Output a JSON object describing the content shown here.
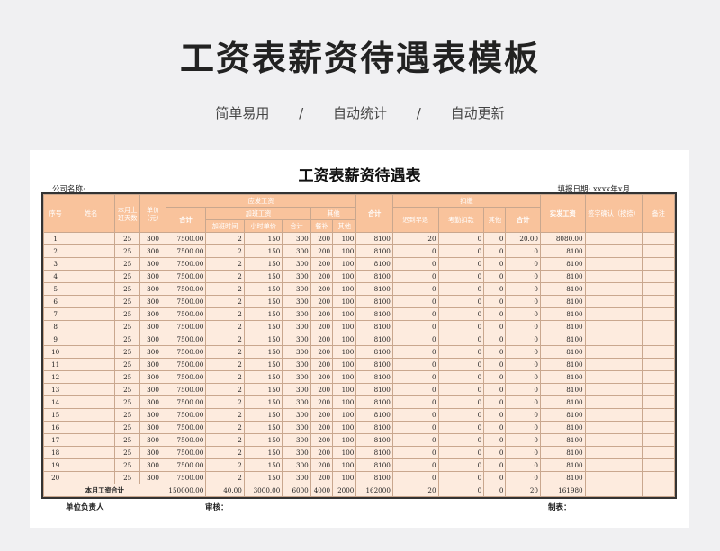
{
  "page": {
    "title": "工资表薪资待遇表模板",
    "taglines": [
      "简单易用",
      "/",
      "自动统计",
      "/",
      "自动更新"
    ]
  },
  "sheet": {
    "title": "工资表薪资待遇表",
    "company_label": "公司名称:",
    "date_label": "填报日期:  xxxx年x月",
    "headers": {
      "seq": "序号",
      "name": "姓名",
      "days": "本月上班天数",
      "unit_price": "单价（元）",
      "payable": "应发工资",
      "deduct": "扣缴",
      "actual": "实发工资",
      "sign": "签字确认（按捺）",
      "remark": "备注",
      "subtotal": "合计",
      "overtime": "加班工资",
      "other": "其他",
      "ot_hours": "加班时间",
      "hourly": "小时单价",
      "meal": "餐补",
      "late": "迟到早退",
      "absence": "考勤扣款"
    },
    "rows": [
      {
        "seq": "1",
        "days": "25",
        "price": "300",
        "subtotal": "7500.00",
        "ot_hours": "2",
        "hourly": "150",
        "ot_total": "300",
        "meal": "200",
        "other": "100",
        "payable": "8100",
        "late": "20",
        "absence": "0",
        "ded_other": "0",
        "ded_total": "20.00",
        "actual": "8080.00"
      },
      {
        "seq": "2",
        "days": "25",
        "price": "300",
        "subtotal": "7500.00",
        "ot_hours": "2",
        "hourly": "150",
        "ot_total": "300",
        "meal": "200",
        "other": "100",
        "payable": "8100",
        "late": "0",
        "absence": "0",
        "ded_other": "0",
        "ded_total": "0",
        "actual": "8100"
      },
      {
        "seq": "3",
        "days": "25",
        "price": "300",
        "subtotal": "7500.00",
        "ot_hours": "2",
        "hourly": "150",
        "ot_total": "300",
        "meal": "200",
        "other": "100",
        "payable": "8100",
        "late": "0",
        "absence": "0",
        "ded_other": "0",
        "ded_total": "0",
        "actual": "8100"
      },
      {
        "seq": "4",
        "days": "25",
        "price": "300",
        "subtotal": "7500.00",
        "ot_hours": "2",
        "hourly": "150",
        "ot_total": "300",
        "meal": "200",
        "other": "100",
        "payable": "8100",
        "late": "0",
        "absence": "0",
        "ded_other": "0",
        "ded_total": "0",
        "actual": "8100"
      },
      {
        "seq": "5",
        "days": "25",
        "price": "300",
        "subtotal": "7500.00",
        "ot_hours": "2",
        "hourly": "150",
        "ot_total": "300",
        "meal": "200",
        "other": "100",
        "payable": "8100",
        "late": "0",
        "absence": "0",
        "ded_other": "0",
        "ded_total": "0",
        "actual": "8100"
      },
      {
        "seq": "6",
        "days": "25",
        "price": "300",
        "subtotal": "7500.00",
        "ot_hours": "2",
        "hourly": "150",
        "ot_total": "300",
        "meal": "200",
        "other": "100",
        "payable": "8100",
        "late": "0",
        "absence": "0",
        "ded_other": "0",
        "ded_total": "0",
        "actual": "8100"
      },
      {
        "seq": "7",
        "days": "25",
        "price": "300",
        "subtotal": "7500.00",
        "ot_hours": "2",
        "hourly": "150",
        "ot_total": "300",
        "meal": "200",
        "other": "100",
        "payable": "8100",
        "late": "0",
        "absence": "0",
        "ded_other": "0",
        "ded_total": "0",
        "actual": "8100"
      },
      {
        "seq": "8",
        "days": "25",
        "price": "300",
        "subtotal": "7500.00",
        "ot_hours": "2",
        "hourly": "150",
        "ot_total": "300",
        "meal": "200",
        "other": "100",
        "payable": "8100",
        "late": "0",
        "absence": "0",
        "ded_other": "0",
        "ded_total": "0",
        "actual": "8100"
      },
      {
        "seq": "9",
        "days": "25",
        "price": "300",
        "subtotal": "7500.00",
        "ot_hours": "2",
        "hourly": "150",
        "ot_total": "300",
        "meal": "200",
        "other": "100",
        "payable": "8100",
        "late": "0",
        "absence": "0",
        "ded_other": "0",
        "ded_total": "0",
        "actual": "8100"
      },
      {
        "seq": "10",
        "days": "25",
        "price": "300",
        "subtotal": "7500.00",
        "ot_hours": "2",
        "hourly": "150",
        "ot_total": "300",
        "meal": "200",
        "other": "100",
        "payable": "8100",
        "late": "0",
        "absence": "0",
        "ded_other": "0",
        "ded_total": "0",
        "actual": "8100"
      },
      {
        "seq": "11",
        "days": "25",
        "price": "300",
        "subtotal": "7500.00",
        "ot_hours": "2",
        "hourly": "150",
        "ot_total": "300",
        "meal": "200",
        "other": "100",
        "payable": "8100",
        "late": "0",
        "absence": "0",
        "ded_other": "0",
        "ded_total": "0",
        "actual": "8100"
      },
      {
        "seq": "12",
        "days": "25",
        "price": "300",
        "subtotal": "7500.00",
        "ot_hours": "2",
        "hourly": "150",
        "ot_total": "300",
        "meal": "200",
        "other": "100",
        "payable": "8100",
        "late": "0",
        "absence": "0",
        "ded_other": "0",
        "ded_total": "0",
        "actual": "8100"
      },
      {
        "seq": "13",
        "days": "25",
        "price": "300",
        "subtotal": "7500.00",
        "ot_hours": "2",
        "hourly": "150",
        "ot_total": "300",
        "meal": "200",
        "other": "100",
        "payable": "8100",
        "late": "0",
        "absence": "0",
        "ded_other": "0",
        "ded_total": "0",
        "actual": "8100"
      },
      {
        "seq": "14",
        "days": "25",
        "price": "300",
        "subtotal": "7500.00",
        "ot_hours": "2",
        "hourly": "150",
        "ot_total": "300",
        "meal": "200",
        "other": "100",
        "payable": "8100",
        "late": "0",
        "absence": "0",
        "ded_other": "0",
        "ded_total": "0",
        "actual": "8100"
      },
      {
        "seq": "15",
        "days": "25",
        "price": "300",
        "subtotal": "7500.00",
        "ot_hours": "2",
        "hourly": "150",
        "ot_total": "300",
        "meal": "200",
        "other": "100",
        "payable": "8100",
        "late": "0",
        "absence": "0",
        "ded_other": "0",
        "ded_total": "0",
        "actual": "8100"
      },
      {
        "seq": "16",
        "days": "25",
        "price": "300",
        "subtotal": "7500.00",
        "ot_hours": "2",
        "hourly": "150",
        "ot_total": "300",
        "meal": "200",
        "other": "100",
        "payable": "8100",
        "late": "0",
        "absence": "0",
        "ded_other": "0",
        "ded_total": "0",
        "actual": "8100"
      },
      {
        "seq": "17",
        "days": "25",
        "price": "300",
        "subtotal": "7500.00",
        "ot_hours": "2",
        "hourly": "150",
        "ot_total": "300",
        "meal": "200",
        "other": "100",
        "payable": "8100",
        "late": "0",
        "absence": "0",
        "ded_other": "0",
        "ded_total": "0",
        "actual": "8100"
      },
      {
        "seq": "18",
        "days": "25",
        "price": "300",
        "subtotal": "7500.00",
        "ot_hours": "2",
        "hourly": "150",
        "ot_total": "300",
        "meal": "200",
        "other": "100",
        "payable": "8100",
        "late": "0",
        "absence": "0",
        "ded_other": "0",
        "ded_total": "0",
        "actual": "8100"
      },
      {
        "seq": "19",
        "days": "25",
        "price": "300",
        "subtotal": "7500.00",
        "ot_hours": "2",
        "hourly": "150",
        "ot_total": "300",
        "meal": "200",
        "other": "100",
        "payable": "8100",
        "late": "0",
        "absence": "0",
        "ded_other": "0",
        "ded_total": "0",
        "actual": "8100"
      },
      {
        "seq": "20",
        "days": "25",
        "price": "300",
        "subtotal": "7500.00",
        "ot_hours": "2",
        "hourly": "150",
        "ot_total": "300",
        "meal": "200",
        "other": "100",
        "payable": "8100",
        "late": "0",
        "absence": "0",
        "ded_other": "0",
        "ded_total": "0",
        "actual": "8100"
      }
    ],
    "totals": {
      "label": "本月工资合计",
      "subtotal": "150000.00",
      "ot_hours": "40.00",
      "ot_total": "3000.00",
      "meal_sum": "6000",
      "other_sum": "4000",
      "other2": "2000",
      "payable": "162000",
      "late": "20",
      "absence": "0",
      "ded_other": "0",
      "ded_total": "20",
      "actual": "161980"
    },
    "footer": {
      "manager": "单位负责人",
      "reviewer": "审核：",
      "preparer": "制表："
    }
  }
}
